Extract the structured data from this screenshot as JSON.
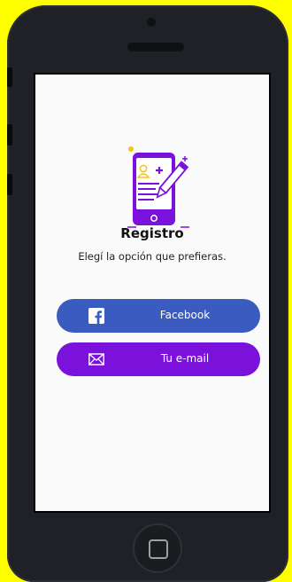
{
  "screen": {
    "title": "Registro",
    "subtitle": "Elegí la opción que prefieras."
  },
  "buttons": {
    "facebook_label": "Facebook",
    "email_label": "Tu e-mail"
  },
  "icons": {
    "illustration": "phone-profile-edit-illustration",
    "facebook": "facebook-icon",
    "email": "mail-icon"
  },
  "colors": {
    "background": "#ffff00",
    "facebook_button": "#3a5cc1",
    "email_button": "#7a12db",
    "accent_purple": "#7a12db",
    "accent_yellow": "#f5c518"
  }
}
